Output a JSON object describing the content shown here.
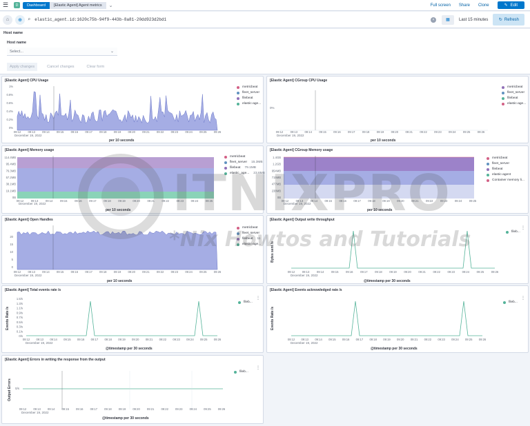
{
  "topbar": {
    "space_initial": "D",
    "crumbs": [
      "Dashboard",
      "[Elastic Agent] Agent metrics"
    ],
    "links": [
      "Full screen",
      "Share",
      "Clone"
    ],
    "edit_label": "Edit"
  },
  "querybar": {
    "query": "elastic_agent.id:1620c75b-94f9-443b-8a81-20dd923d2bd1",
    "range": "Last 15 minutes",
    "refresh_label": "Refresh"
  },
  "controls": {
    "title": "Host name",
    "field_label": "Host name",
    "placeholder": "Select...",
    "apply": "Apply changes",
    "cancel": "Cancel changes",
    "clear": "Clear form"
  },
  "panels": {
    "cpu": {
      "title": "[Elastic Agent] CPU Usage",
      "xlabel": "per 10 seconds",
      "date": "December 19, 2022",
      "legend": [
        "metricbeat",
        "fleet_server",
        "filebeat",
        "elastic-age..."
      ],
      "yticks": [
        "1%",
        "0.8%",
        "0.6%",
        "0.4%",
        "0.2%",
        "0%"
      ]
    },
    "cgroup_cpu": {
      "title": "[Elastic Agent] CGroup CPU Usage",
      "xlabel": "per 10 seconds",
      "date": "December 19, 2022",
      "legend": [
        "metricbeat",
        "fleet_server",
        "filebeat",
        "elastic-age..."
      ],
      "yticks": [
        "0%"
      ]
    },
    "memory": {
      "title": "[Elastic Agent] Memory usage",
      "xlabel": "per 10 seconds",
      "date": "December 19, 2022",
      "legend": [
        "metricbeat",
        "fleet_server",
        "filebeat",
        "elastic_age..."
      ],
      "legend_values": [
        "",
        "15.3MB",
        "79.1MB",
        "23.6MB"
      ],
      "yticks": [
        "114.4MB",
        "95.4MB",
        "76.3MB",
        "57.2MB",
        "38.1MB",
        "19.1MB",
        "0B"
      ]
    },
    "cgroup_memory": {
      "title": "[Elastic Agent] CGroup Memory usage",
      "xlabel": "per 10 seconds",
      "date": "December 19, 2022",
      "legend": [
        "metricbeat",
        "fleet_server",
        "filebeat",
        "elastic-agent",
        "Container memory li..."
      ],
      "yticks": [
        "1.4GB",
        "1.2GB",
        "954MB",
        "715MB",
        "477MB",
        "238MB",
        "0B"
      ]
    },
    "handles": {
      "title": "[Elastic Agent] Open Handles",
      "xlabel": "per 10 seconds",
      "date": "December 19, 2022",
      "legend": [
        "metricbeat",
        "fleet_server",
        "filebeat",
        "elastic-age..."
      ],
      "legend_values": [
        "",
        "",
        "11",
        ""
      ],
      "yticks": [
        "20",
        "15",
        "10",
        "5",
        "0"
      ]
    },
    "throughput": {
      "title": "[Elastic Agent] Output write throughput",
      "xlabel": "@timestamp per 30 seconds",
      "ylabel": "Bytes sent /s",
      "date": "December 19, 2022",
      "legend": [
        "fileb..."
      ]
    },
    "events_total": {
      "title": "[Elastic Agent] Total events rate /s",
      "xlabel": "@timestamp per 30 seconds",
      "ylabel": "Events Rate /s",
      "date": "December 19, 2022",
      "legend": [
        "fileb..."
      ],
      "yticks": [
        "1.5/s",
        "1.3/s",
        "1.1/s",
        "0.9/s",
        "0.7/s",
        "0.5/s",
        "0.3/s",
        "0.1/s",
        "0/s"
      ]
    },
    "events_ack": {
      "title": "[Elastic Agent] Events acknowledged rate /s",
      "xlabel": "@timestamp per 30 seconds",
      "ylabel": "Events Rate /s",
      "date": "December 19, 2022",
      "legend": [
        "fileb..."
      ]
    },
    "errors": {
      "title": "[Elastic Agent] Errors in writing the response from the output",
      "xlabel": "@timestamp per 30 seconds",
      "ylabel": "Output Errors",
      "date": "December 19, 2022",
      "legend": [
        "fileb..."
      ],
      "yticks": [
        "0/s"
      ]
    }
  },
  "xticks_10s": [
    "09:12",
    "09:13",
    "09:14",
    "09:15",
    "09:16",
    "09:17",
    "09:18",
    "09:19",
    "09:20",
    "09:21",
    "09:22",
    "09:23",
    "09:24",
    "09:25",
    "09:26"
  ],
  "watermark": {
    "brand": "ITNIXPRO",
    "tagline": "*Nix Howtos and Tutorials"
  },
  "colors": {
    "metricbeat": "#9170b8",
    "fleet_server": "#6092c0",
    "filebeat": "#8b80d6",
    "elastic_agent": "#54b399",
    "container_limit": "#d36086",
    "accent": "#0077cc"
  }
}
